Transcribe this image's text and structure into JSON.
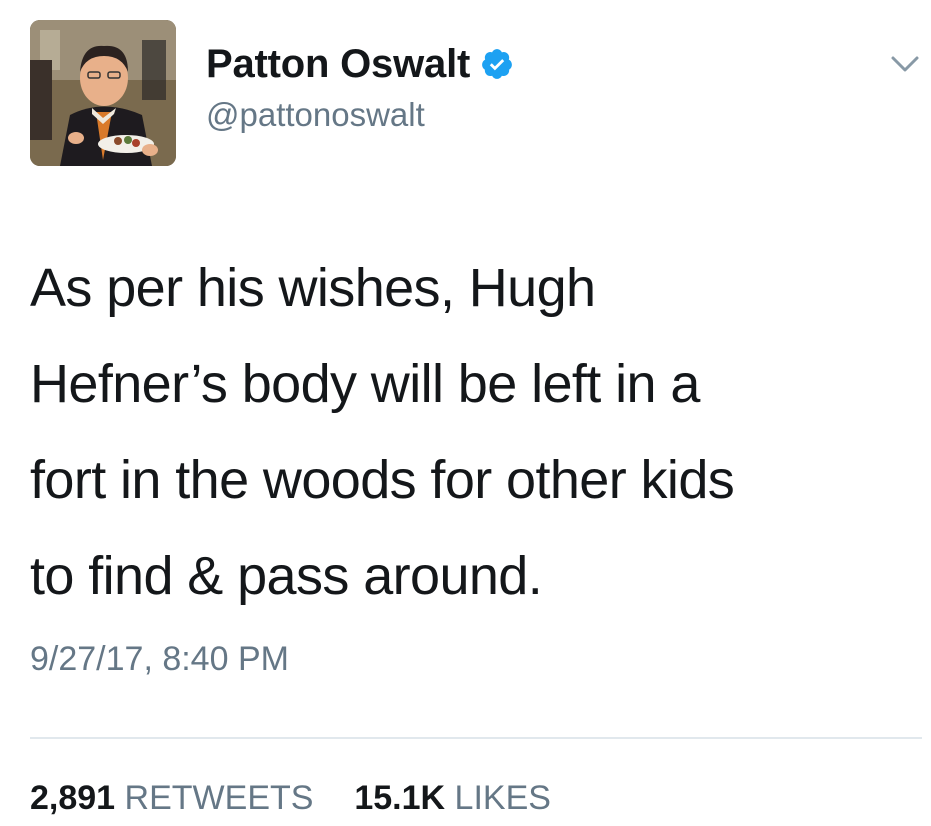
{
  "user": {
    "display_name": "Patton Oswalt",
    "handle": "@pattonoswalt",
    "verified": true,
    "avatar_icon": "profile-photo"
  },
  "tweet": {
    "lines": [
      "As per his wishes, Hugh",
      "Hefner’s body will be left in a",
      "fort in the woods for other kids",
      "to find & pass around."
    ],
    "timestamp": "9/27/17, 8:40 PM"
  },
  "stats": {
    "retweets_count": "2,891",
    "retweets_label": "RETWEETS",
    "likes_count": "15.1K",
    "likes_label": "LIKES"
  },
  "icons": {
    "verified": "verified-badge-icon",
    "menu": "chevron-down-icon"
  },
  "colors": {
    "verified_blue": "#1da1f2",
    "secondary_text": "#657786",
    "divider": "#e1e8ed"
  }
}
